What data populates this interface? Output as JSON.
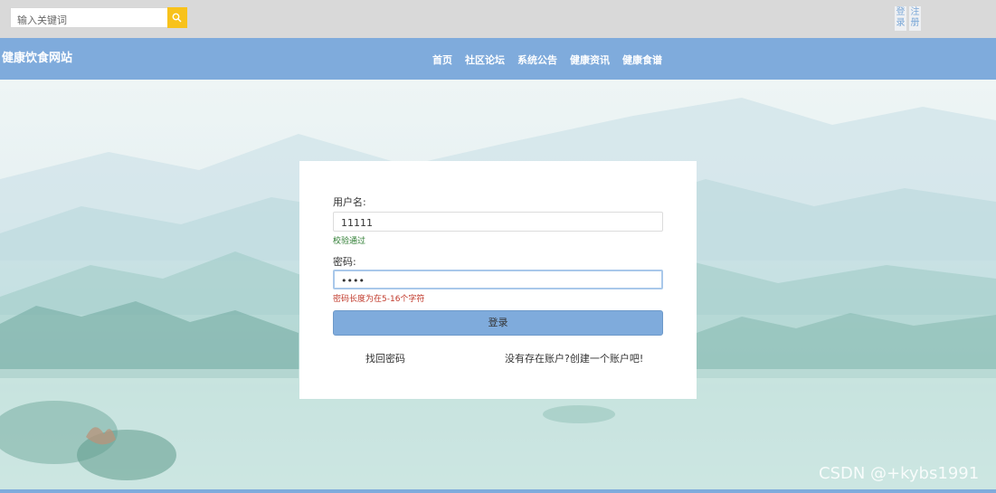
{
  "topbar": {
    "search_placeholder": "输入关键词",
    "login_label": "登录",
    "register_label": "注册"
  },
  "navbar": {
    "site_title": "健康饮食网站",
    "items": [
      "首页",
      "社区论坛",
      "系统公告",
      "健康资讯",
      "健康食谱"
    ]
  },
  "login_form": {
    "username_label": "用户名:",
    "username_value": "11111",
    "username_hint": "校验通过",
    "password_label": "密码:",
    "password_value": "••••",
    "password_hint": "密码长度为在5-16个字符",
    "submit_label": "登录",
    "forgot_link": "找回密码",
    "register_link": "没有存在账户?创建一个账户吧!"
  },
  "watermark": "CSDN @+kybs1991",
  "colors": {
    "nav_bg": "#7fabdc",
    "search_button": "#f8c21b",
    "success": "#2e7d32",
    "error": "#c0392b"
  }
}
